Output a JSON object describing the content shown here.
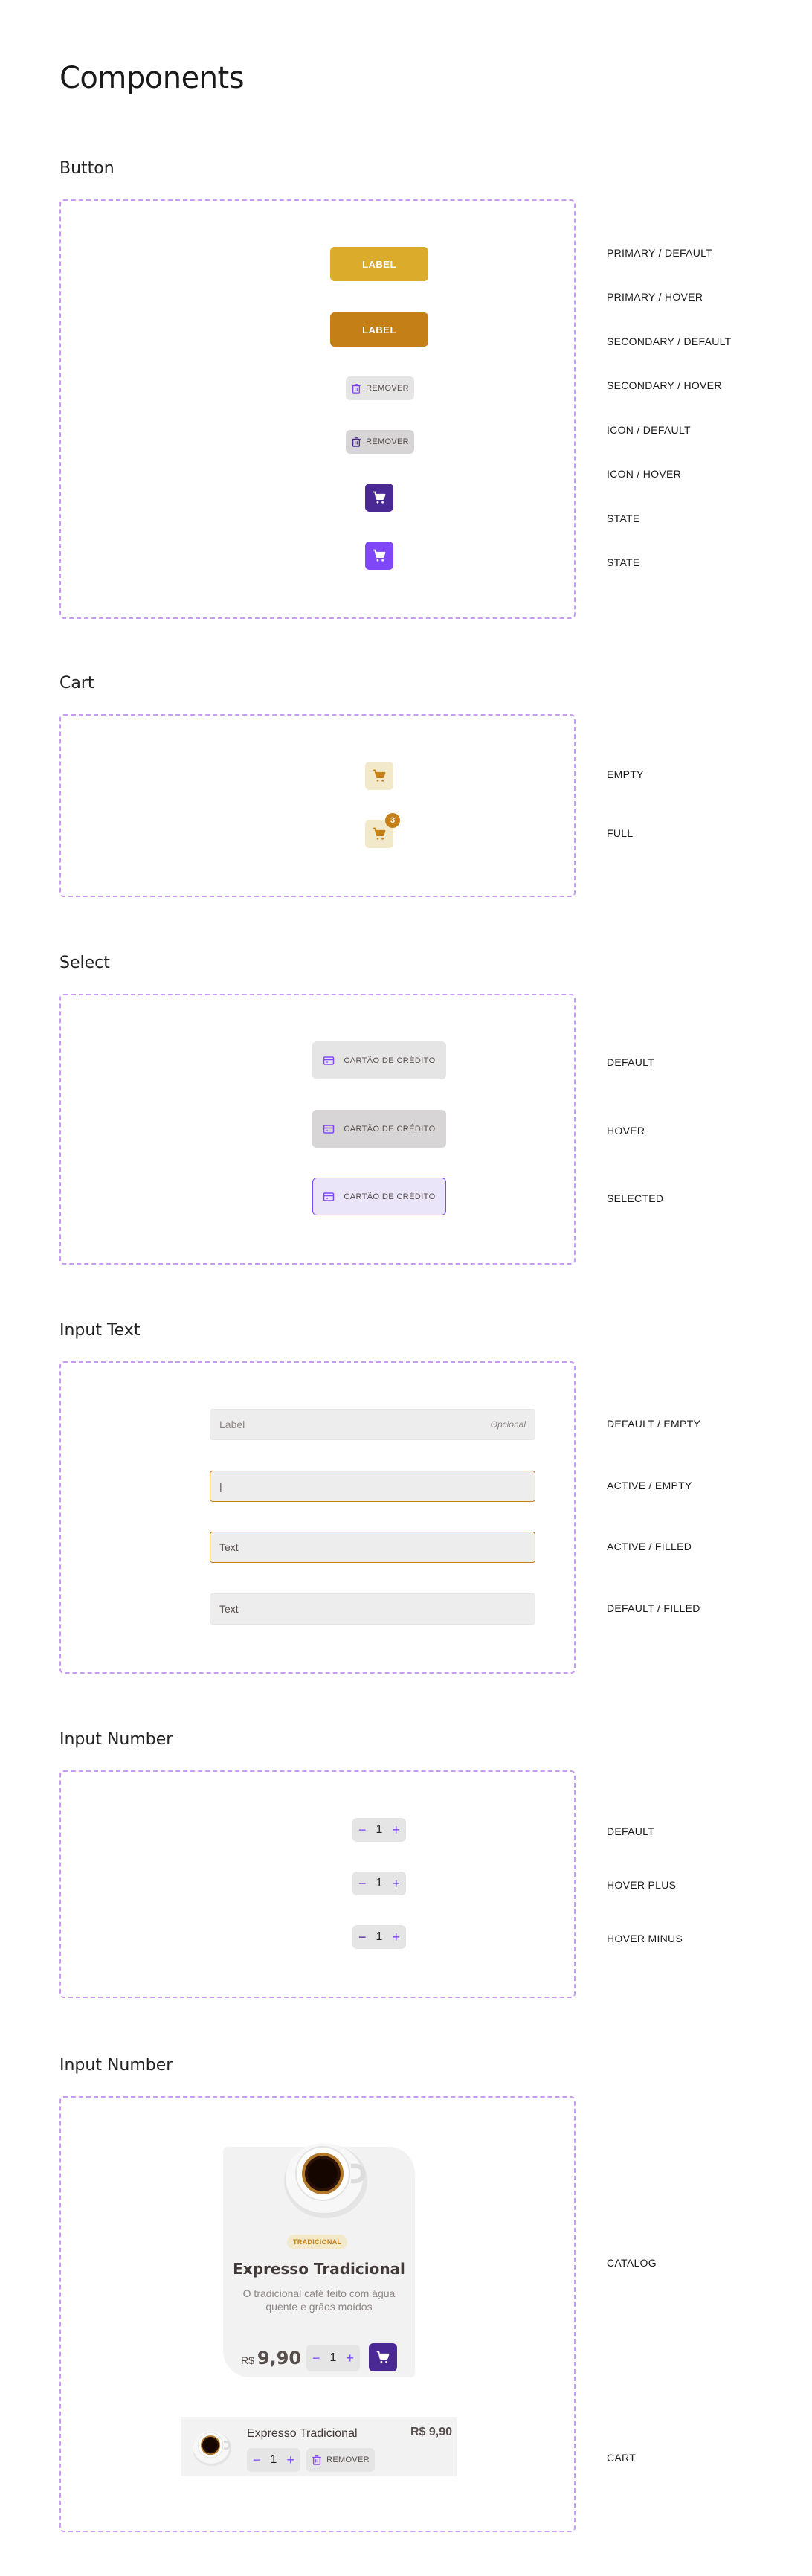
{
  "page_title": "Components",
  "colors": {
    "yellow": "#dbac2c",
    "yellow_dark": "#c47f17",
    "yellow_light": "#f1e9c9",
    "purple": "#8047f8",
    "purple_dark": "#4b2995",
    "purple_light": "#ebe5f9",
    "frame_border": "#c79cf5"
  },
  "button_section": {
    "title": "Button",
    "primary_label": "LABEL",
    "secondary_label": "LABEL",
    "remove_label": "REMOVER",
    "variants": [
      "PRIMARY / DEFAULT",
      "PRIMARY / HOVER",
      "SECONDARY / DEFAULT",
      "SECONDARY / HOVER",
      "ICON / DEFAULT",
      "ICON / HOVER",
      "STATE",
      "STATE"
    ]
  },
  "cart_section": {
    "title": "Cart",
    "badge_count": "3",
    "variants": [
      "EMPTY",
      "FULL"
    ]
  },
  "select_section": {
    "title": "Select",
    "option_label": "CARTÃO DE CRÉDITO",
    "variants": [
      "DEFAULT",
      "HOVER",
      "SELECTED"
    ]
  },
  "input_text_section": {
    "title": "Input Text",
    "placeholder": "Label",
    "optional_hint": "Opcional",
    "cursor": "|",
    "filled_value": "Text",
    "variants": [
      "DEFAULT / EMPTY",
      "ACTIVE / EMPTY",
      "ACTIVE / FILLED",
      "DEFAULT / FILLED"
    ]
  },
  "input_number_section": {
    "title": "Input Number",
    "value": "1",
    "minus": "−",
    "plus": "+",
    "variants": [
      "DEFAULT",
      "HOVER PLUS",
      "HOVER MINUS"
    ]
  },
  "product_section": {
    "title": "Input Number",
    "catalog": {
      "tag": "TRADICIONAL",
      "name": "Expresso Tradicional",
      "description": "O tradicional café feito com água quente e grãos moídos",
      "currency": "R$",
      "price": "9,90",
      "quantity": "1"
    },
    "cart_item": {
      "name": "Expresso Tradicional",
      "price": "R$ 9,90",
      "quantity": "1",
      "remove_label": "REMOVER"
    },
    "variants": [
      "CATALOG",
      "CART"
    ]
  }
}
